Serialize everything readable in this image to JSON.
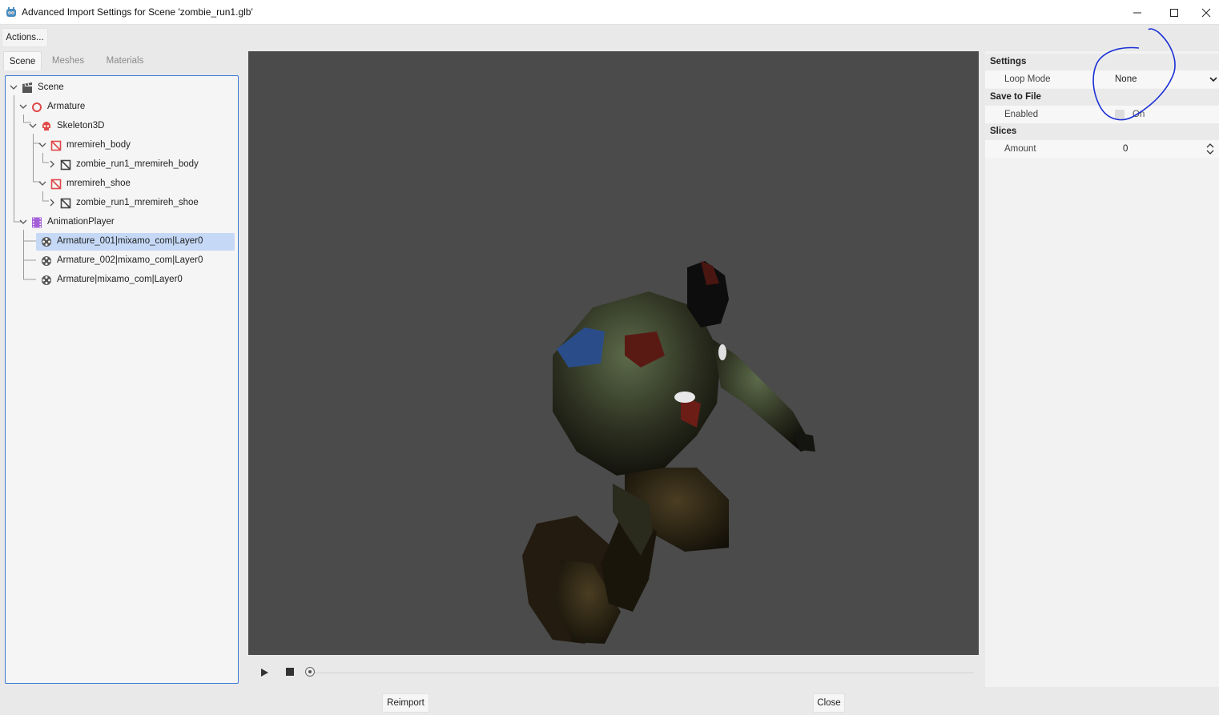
{
  "window": {
    "title": "Advanced Import Settings for Scene 'zombie_run1.glb'",
    "app_icon": "godot-icon"
  },
  "toolbar": {
    "actions_label": "Actions..."
  },
  "tabs": [
    {
      "label": "Scene",
      "active": true
    },
    {
      "label": "Meshes",
      "active": false
    },
    {
      "label": "Materials",
      "active": false
    }
  ],
  "tree": [
    {
      "label": "Scene",
      "icon": "clapperboard-icon",
      "depth": 0
    },
    {
      "label": "Armature",
      "icon": "node3d-icon",
      "depth": 1
    },
    {
      "label": "Skeleton3D",
      "icon": "skull-icon",
      "depth": 2
    },
    {
      "label": "mremireh_body",
      "icon": "mesh-instance-icon",
      "depth": 3
    },
    {
      "label": "zombie_run1_mremireh_body",
      "icon": "mesh-icon",
      "depth": 4
    },
    {
      "label": "mremireh_shoe",
      "icon": "mesh-instance-icon",
      "depth": 3
    },
    {
      "label": "zombie_run1_mremireh_shoe",
      "icon": "mesh-icon",
      "depth": 4
    },
    {
      "label": "AnimationPlayer",
      "icon": "film-icon",
      "depth": 1
    },
    {
      "label": "Armature_001|mixamo_com|Layer0",
      "icon": "animation-icon",
      "depth": 2,
      "selected": true
    },
    {
      "label": "Armature_002|mixamo_com|Layer0",
      "icon": "animation-icon",
      "depth": 2
    },
    {
      "label": "Armature|mixamo_com|Layer0",
      "icon": "animation-icon",
      "depth": 2
    }
  ],
  "playback": {
    "progress": 0
  },
  "inspector": {
    "settings": {
      "header": "Settings",
      "loop_mode_label": "Loop Mode",
      "loop_mode_value": "None"
    },
    "save_to_file": {
      "header": "Save to File",
      "enabled_label": "Enabled",
      "enabled_value": "On"
    },
    "slices": {
      "header": "Slices",
      "amount_label": "Amount",
      "amount_value": "0"
    }
  },
  "footer": {
    "reimport_label": "Reimport",
    "close_label": "Close"
  }
}
